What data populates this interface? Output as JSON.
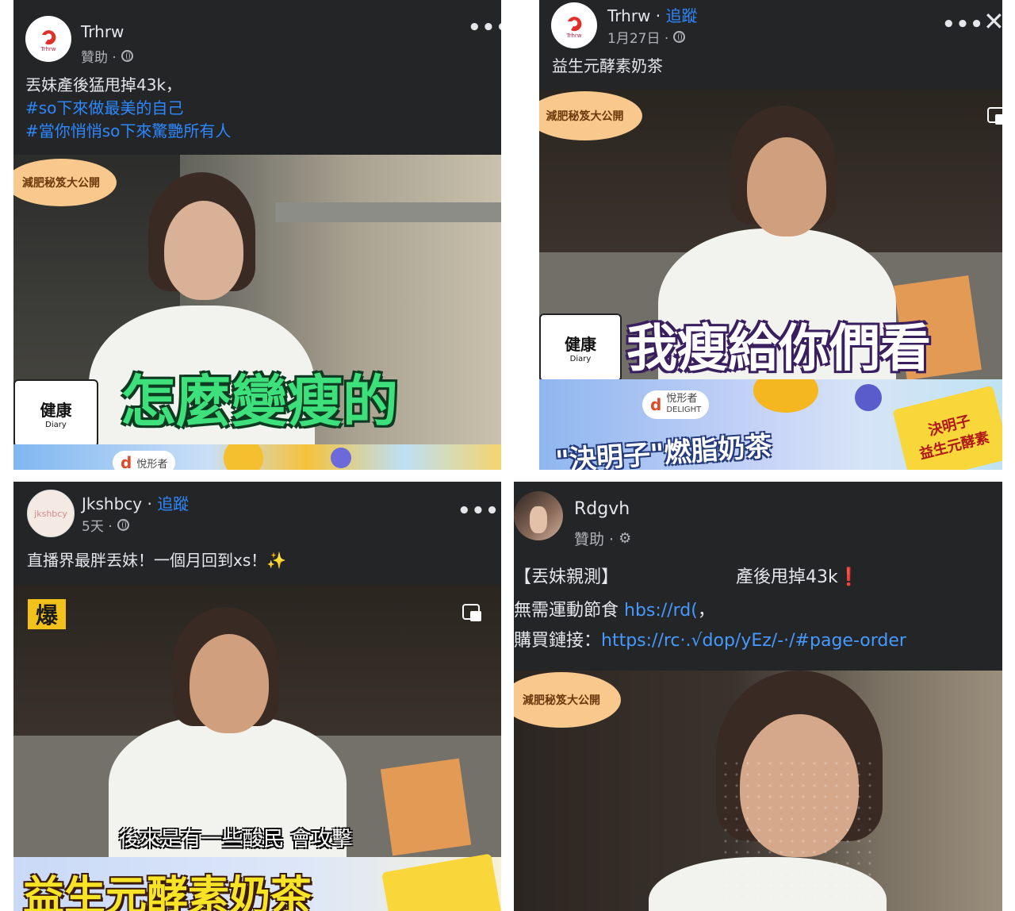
{
  "posts": [
    {
      "author": "Trhrw",
      "meta": "贊助 ·",
      "lines": [
        "丟妹產後猛甩掉43k，"
      ],
      "hashtags": [
        "#so下來做最美的自己",
        "#當你悄悄so下來驚艷所有人"
      ],
      "overlay": {
        "bubble": "減肥秘笈大公開",
        "badge_title": "健康",
        "badge_sub": "Diary",
        "caption": "怎麼變瘦的",
        "brand": "悅形者"
      },
      "avatar_text": "Trhrw"
    },
    {
      "author": "Trhrw",
      "follow": "追蹤",
      "meta": "1月27日 ·",
      "lines": [
        "益生元酵素奶茶"
      ],
      "overlay": {
        "bubble": "減肥秘笈大公開",
        "badge_title": "健康",
        "badge_sub": "Diary",
        "caption": "我瘦給你們看",
        "brand_name": "悅形者",
        "brand_en": "DELIGHT",
        "banner_text": "\"決明子\"燃脂奶茶",
        "package_text": "決明子\n益生元酵素"
      },
      "avatar_text": "Trhrw"
    },
    {
      "author": "Jkshbcy",
      "follow": "追蹤",
      "meta": "5天 ·",
      "lines": [
        "直播界最胖丟妹！一個月回到xs！✨"
      ],
      "overlay": {
        "corner_logo": "爆",
        "subtitle": "後來是有一些酸民 會攻擊",
        "caption": "益生元酵素奶茶"
      },
      "avatar_text": "jkshbcy"
    },
    {
      "author": "Rdgvh",
      "meta": "贊助 ·",
      "line1_prefix": "【丟妹親測】",
      "line1_suffix": "產後甩掉43k",
      "line2_label": "無需運動節食",
      "line2_link": "hbs://rd(",
      "line3_label": "購買鏈接：",
      "line3_link": "https://rc·.√dop/yEz/-·/#page-order",
      "overlay": {
        "bubble": "減肥秘笈大公開"
      }
    }
  ],
  "icons": {
    "more": "•••",
    "close": "✕",
    "red_exclamation": "❗",
    "comma": "，"
  },
  "colors": {
    "card_bg": "#242526",
    "link": "#2d88ff",
    "text": "#e4e6eb",
    "secondary": "#b0b3b8"
  }
}
